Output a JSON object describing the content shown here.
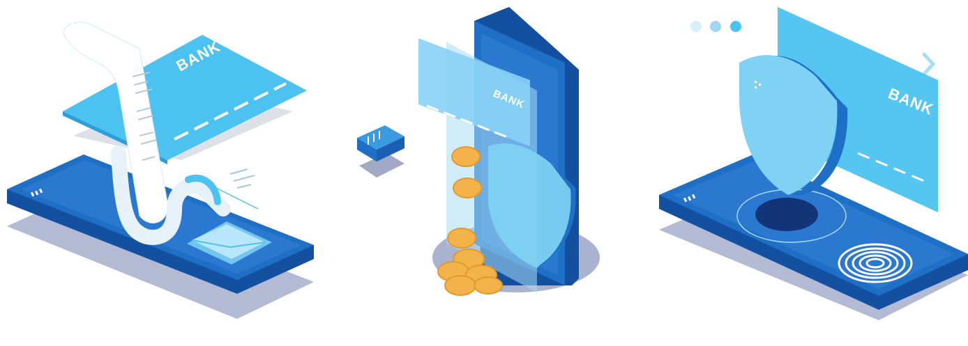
{
  "illustrations": [
    {
      "id": "payment-receipt",
      "card_label": "BANK"
    },
    {
      "id": "mobile-wallet-security",
      "card_label": "BANK"
    },
    {
      "id": "biometric-protection",
      "card_label": "BANK"
    }
  ],
  "colors": {
    "primary_blue": "#1a5fb4",
    "phone_blue": "#1e6fc6",
    "light_blue": "#4cc2f0",
    "pale_blue": "#a9dcf5",
    "shadow": "#9aa4c6",
    "coin": "#f4b24a"
  },
  "icons": [
    "receipt-icon",
    "envelope-icon",
    "shield-icon",
    "coin-icon",
    "fingerprint-icon",
    "chevron-right-icon",
    "dots-icon"
  ]
}
